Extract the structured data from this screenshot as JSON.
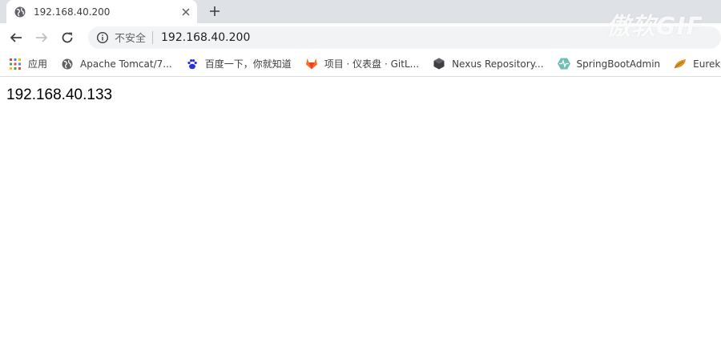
{
  "tab": {
    "title": "192.168.40.200",
    "close": "×",
    "new_tab": "+"
  },
  "watermark": "傲软GIF",
  "omnibox": {
    "security_label": "不安全",
    "url": "192.168.40.200"
  },
  "bookmarks": [
    {
      "label": "应用",
      "icon": "apps-grid-icon"
    },
    {
      "label": "Apache Tomcat/7...",
      "icon": "globe-icon"
    },
    {
      "label": "百度一下，你就知道",
      "icon": "baidu-paw-icon"
    },
    {
      "label": "项目 · 仪表盘 · GitL...",
      "icon": "gitlab-fox-icon"
    },
    {
      "label": "Nexus Repository...",
      "icon": "nexus-cube-icon"
    },
    {
      "label": "SpringBootAdmin",
      "icon": "heartbeat-icon"
    },
    {
      "label": "Eureka",
      "icon": "eureka-leaf-icon"
    }
  ],
  "page": {
    "text": "192.168.40.133"
  },
  "colors": {
    "tabstrip": "#dee1e6",
    "omnibox": "#f1f3f4",
    "gitlab": "#e24329",
    "baidu": "#2932e1",
    "spring": "#6db33f"
  }
}
